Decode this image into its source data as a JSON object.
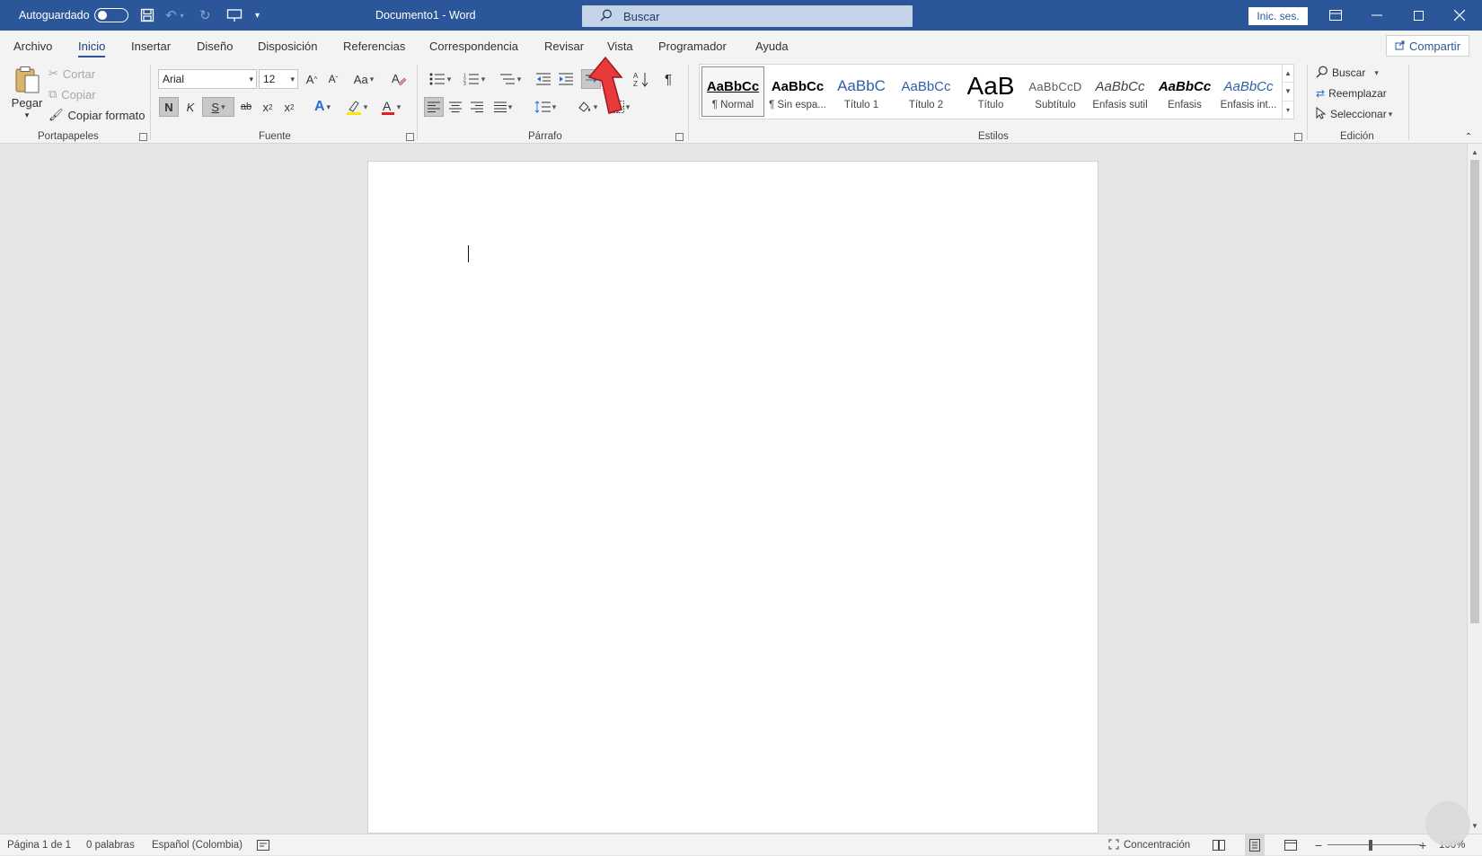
{
  "titlebar": {
    "autosave_label": "Autoguardado",
    "doc_title": "Documento1 - Word",
    "search_placeholder": "Buscar",
    "signin_label": "Inic. ses."
  },
  "tabs": [
    "Archivo",
    "Inicio",
    "Insertar",
    "Diseño",
    "Disposición",
    "Referencias",
    "Correspondencia",
    "Revisar",
    "Vista",
    "Programador",
    "Ayuda"
  ],
  "active_tab": "Inicio",
  "share_label": "Compartir",
  "clipboard": {
    "paste_label": "Pegar",
    "cut_label": "Cortar",
    "copy_label": "Copiar",
    "format_painter_label": "Copiar formato",
    "group_label": "Portapapeles"
  },
  "font": {
    "font_name": "Arial",
    "font_size": "12",
    "case_label": "Aa",
    "bold_label": "N",
    "italic_label": "K",
    "underline_label": "S",
    "strike_label": "ab",
    "subscript_label": "x",
    "superscript_label": "x",
    "group_label": "Fuente"
  },
  "paragraph": {
    "group_label": "Párrafo"
  },
  "styles": {
    "group_label": "Estilos",
    "items": [
      {
        "preview": "AaBbCc",
        "name": "¶ Normal"
      },
      {
        "preview": "AaBbCc",
        "name": "¶ Sin espa..."
      },
      {
        "preview": "AaBbC",
        "name": "Título 1"
      },
      {
        "preview": "AaBbCc",
        "name": "Título 2"
      },
      {
        "preview": "AaB",
        "name": "Título"
      },
      {
        "preview": "AaBbCcD",
        "name": "Subtítulo"
      },
      {
        "preview": "AaBbCc",
        "name": "Énfasis sutil"
      },
      {
        "preview": "AaBbCc",
        "name": "Énfasis"
      },
      {
        "preview": "AaBbCc",
        "name": "Énfasis int..."
      }
    ]
  },
  "editing": {
    "find_label": "Buscar",
    "replace_label": "Reemplazar",
    "select_label": "Seleccionar",
    "group_label": "Edición"
  },
  "status": {
    "page": "Página 1 de 1",
    "words": "0 palabras",
    "language": "Español (Colombia)",
    "focus_label": "Concentración",
    "zoom": "100%"
  },
  "colors": {
    "accent": "#2b579a",
    "annotation_arrow": "#e83a3a"
  }
}
